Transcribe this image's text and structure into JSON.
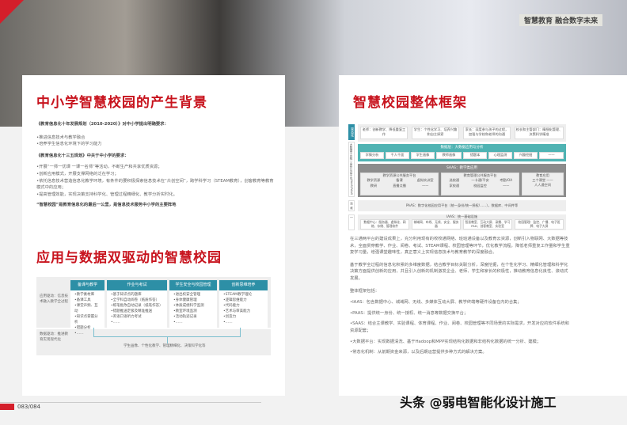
{
  "header": {
    "slogan": "智慧教育 融合数字未来"
  },
  "left": {
    "title1": "中小学智慧校园的产生背景",
    "req1_title": "《教育信息化十年发展规划（2010-2020）》对中小学提出明确要求：",
    "req1_items": [
      "•推进信息技术与教学融合",
      "•培养学生信息化环境下的学习能力"
    ],
    "req2_title": "《教育信息化十三五规划》中关于中小学的要求：",
    "req2_items": [
      "•开展“一师一优课 一课一名师”等活动，不断生产和共享优质资源；",
      "•创新应用模式，开展支撑网络的泛在学习；",
      "•依托信息技术营造信息化教学环境，有条件的要积极探索信息技术在“众创空间”，跨学科学习（STEAM教育），创客教育等教育模式中的应用；",
      "•提高管理效能，实现决策支持科学化、管理过程精细化、教学分析实时化。"
    ],
    "conclusion": "“智慧校园”是教育信息化的最后一公里，是信息技术服务中小学的主要阵地",
    "title2": "应用与数据双驱动的智慧校园",
    "diagram": {
      "row1_label": "应用驱动：信息技术融入教学全过程",
      "row2_label": "数据驱动：推进教育实现现代化",
      "bottom_text": "学生画像、个性化教学、管理精细化、决策科学化等",
      "columns": [
        {
          "title": "备课与教学",
          "items": [
            "•教学素材库",
            "•备课工具",
            "•课堂声频、互动",
            "•知识点掌握分析",
            "•错题分析",
            "•……"
          ]
        },
        {
          "title": "作业与考试",
          "items": [
            "•基于知识点的题库",
            "•全学科自动阅卷（纸质作答）",
            "•练笔批改自动记录（纸笔作答）",
            "•错题推送定极及精准推送",
            "•英语口语听力考试",
            "•……"
          ]
        },
        {
          "title": "学生安全与校园管理",
          "items": [
            "•进出校安全管理",
            "•身体健康管理",
            "•体质成绩科学监测",
            "•教室环境监测",
            "•活动轨迹记录",
            "•……"
          ]
        },
        {
          "title": "创新思维培养",
          "items": [
            "•STEAM教学理论",
            "•逻辑思维能力",
            "•代码能力",
            "•艺术与审美能力",
            "•创造力",
            "•……"
          ]
        }
      ]
    }
  },
  "right": {
    "title": "智慧校园整体框架",
    "framework": {
      "side": [
        "常态化",
        "大数据平台统一身份认证平台SAAS/PAAS",
        "运维",
        "—"
      ],
      "roles": [
        "老师：创新教学、降低重复工作",
        "学生：个性化学习、培养兴趣和自主探索",
        "家长：深度参与孩子的过程，加强与学校和老师的沟通",
        "校长和主管部门：精细化管理、决策科学精准"
      ],
      "bigdata_title": "数据层：大数据应用与分析",
      "bigdata_items": [
        "学情分析",
        "千人千面",
        "学生画像",
        "教师画像",
        "错题本",
        "心理监测",
        "兴趣挖掘",
        "——"
      ],
      "saas_title": "SAAS：教学类应用",
      "group1_title": "教学资源公共服务平台",
      "group1_items": [
        "教学资源",
        "备课",
        "虚拟实训室",
        "教研",
        "直播点播",
        "——"
      ],
      "group2_title": "教育管理公共服务平台",
      "group2_items": [
        "选校通",
        "一卡通/平安",
        "考勤/OA",
        "家校通",
        "校园监控",
        "——"
      ],
      "group3_title": "教育应用",
      "group3_items": [
        "三个课堂",
        "——",
        "人人通空间"
      ],
      "paas": "PAAS：数字化校园应用平台（统一身份/统一授权/……），数据库、中间件等",
      "iaas_title": "IAAS：统一基础设施",
      "iaas_items": [
        "数据中心：服务器、虚拟化、网络、存储、管理软件",
        "城域网、布线、无线、安全、服务器",
        "智慧教室、互动大屏、录播、学习PAD、创客教室、实验室",
        "校园管理：监控、广播、电子班牌、电子大屏"
      ]
    },
    "para1": "在三通两平台的建设成果上，充分利用现有的校校通网络、班班通设备以及教育云资源，创新引入物联网、大数据等技术，全面贯穿教学、作业、阅卷、考试、STEAM课程、校园管理等环节，优化教学流程，降低老师重复工作量和学生重复学习量，增强课堂趣味性，真正意义上实现信息技术与教育教学的深度融合。",
    "para2": "基于教学全过程的信息化积累的多维度数据，结合教学目标关联分析，深度挖掘，在个性化学习、精细化管理和科学化决策方面提供创新的应用，并且引入创新的机制激发企业、老师、学生和家长的积极性，推动教育信息化良性、滚动式发展。",
    "list_title": "整体框架包括：",
    "list": [
      "•IAAS：包含数据中心、城域网、无线、多媒体互动大屏、教学终端等硬件设备在内的合集；",
      "•PAAS：提供统一身份、统一授权、统一消息等数据交换平台；",
      "•SAAS：结合主课教学、实验课程、体育课程、作业、阅卷、校园管理等不同场景的实际需求，开发对应的软件系统和资源配套；",
      "•大数据平台：实现数据清洗、基于Hadoop和MPP实现结构化数据和非结构化数据的统一分析、建模；",
      "•常态化机制：从前期资金来源，以及后期运营提供多种方式的解决方案。"
    ]
  },
  "footer": {
    "page": "083/084",
    "watermark": "头条 @弱电智能化设计施工"
  },
  "colors": {
    "red": "#c8141e",
    "teal": "#2d8fa6",
    "frameteal": "#4fb3b3",
    "gray": "#8c8c8c"
  }
}
